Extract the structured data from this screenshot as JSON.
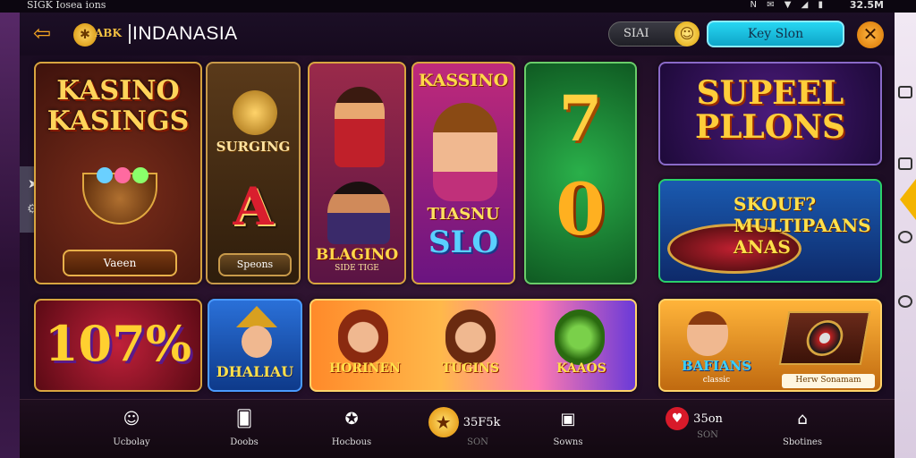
{
  "statusbar": {
    "left_text": "SIGK Iosea ions",
    "icons": "N ✉ ▼ ◢ ▮",
    "time": "32.5M"
  },
  "header": {
    "back_icon": "back-arrow-icon",
    "logo_abbrev": "ABK",
    "brand": "INDANASIA",
    "balance_label": "SIAI",
    "signin_label": "Key Slon",
    "close_icon": "close-icon"
  },
  "tiles": {
    "kasino_kasings": {
      "title_line1": "KASINO",
      "title_line2": "KASINGS",
      "button": "Vaeen"
    },
    "surging": {
      "title": "SURGING",
      "big_letter": "A",
      "button": "Speons"
    },
    "blagino": {
      "title": "BLAGINO",
      "subtitle": "SIDE TIGE"
    },
    "kassino_slo": {
      "title": "KASSINO",
      "line2": "TIASNU",
      "line3": "SLO"
    },
    "sevens": {
      "top": "7",
      "bottom": "0"
    },
    "super_pllons": {
      "title_line1": "SUPEEL",
      "title_line2": "PLLONS"
    },
    "multipaans": {
      "title": "SKOUF? MULTIPAANS ANAS"
    },
    "pct": {
      "title": "107%"
    },
    "dhalian": {
      "title": "DHALIAU"
    },
    "trio": {
      "left": "HORINEN",
      "mid": "TUGINS",
      "right": "KAAOS"
    },
    "bafians": {
      "title": "BAFIANS",
      "subtitle": "classic",
      "button": "Herw Sonamam"
    }
  },
  "nav": [
    {
      "label": "Ucbolay",
      "icon": "user-icon"
    },
    {
      "label": "Doobs",
      "icon": "cards-icon"
    },
    {
      "label": "Hocbous",
      "icon": "star-badge-icon"
    },
    {
      "value": "35F5k",
      "label": "SON",
      "icon": "star-coin-icon"
    },
    {
      "label": "Sowns",
      "icon": "gift-box-icon"
    },
    {
      "value": "35on",
      "label": "SON",
      "icon": "heart-icon"
    },
    {
      "label": "Sbotines",
      "icon": "shop-icon"
    }
  ],
  "colors": {
    "accent": "#f5a623",
    "signin": "#27d6f2",
    "frame": "#d8a540"
  }
}
